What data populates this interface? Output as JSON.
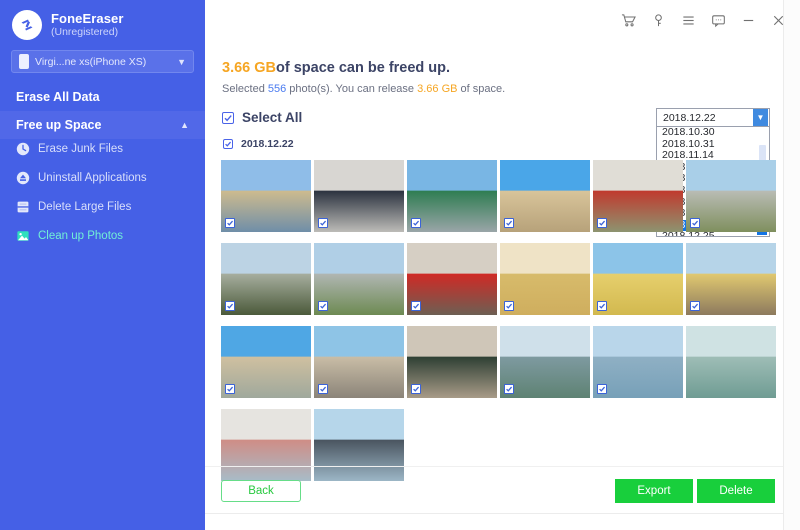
{
  "app": {
    "name": "FoneEraser",
    "license": "(Unregistered)",
    "logo_icon": "fone-eraser-logo-icon"
  },
  "sidebar": {
    "device": {
      "name": "Virgi...ne xs(iPhone XS)",
      "icon": "phone-icon",
      "chevron": "chevron-down-icon"
    },
    "sections": [
      {
        "label": "Erase All Data",
        "expanded": false
      },
      {
        "label": "Free up Space",
        "expanded": true,
        "caret": "chevron-up-icon"
      }
    ],
    "items": [
      {
        "label": "Erase Junk Files",
        "icon": "clock-icon",
        "active": false
      },
      {
        "label": "Uninstall Applications",
        "icon": "uninstall-icon",
        "active": false
      },
      {
        "label": "Delete Large Files",
        "icon": "file-icon",
        "active": false
      },
      {
        "label": "Clean up Photos",
        "icon": "photo-icon",
        "active": true
      }
    ]
  },
  "titlebar": {
    "buttons": [
      {
        "name": "cart-icon",
        "label": "Cart"
      },
      {
        "name": "key-icon",
        "label": "Register"
      },
      {
        "name": "menu-icon",
        "label": "Menu"
      },
      {
        "name": "feedback-icon",
        "label": "Feedback"
      },
      {
        "name": "minimize-icon",
        "label": "Minimize"
      },
      {
        "name": "close-icon",
        "label": "Close"
      }
    ]
  },
  "main": {
    "headline_size": "3.66 GB",
    "headline_rest": "of space can be freed up.",
    "subline_prefix": "Selected ",
    "subline_count": "556",
    "subline_mid": " photo(s). You can release ",
    "subline_size": "3.66 GB",
    "subline_suffix": " of space.",
    "select_all_label": "Select All",
    "group_date": "2018.12.22",
    "select_all_checked": true,
    "group_checked": true
  },
  "date_combo": {
    "value": "2018.12.22",
    "open": true,
    "selected": "2018.12.22",
    "options": [
      "2018.10.30",
      "2018.10.31",
      "2018.11.14",
      "2018.11.15",
      "2018.11.19",
      "2018.11.21",
      "2018.12.04",
      "2018.12.05",
      "2018.12.22",
      "2018.12.25"
    ]
  },
  "photos": [
    {
      "id": 1,
      "alt": "grand-lisboa-dome",
      "checked": true,
      "c1": "#8fbde8",
      "c2": "#cdbb8e",
      "c3": "#6f8ea8"
    },
    {
      "id": 2,
      "alt": "shark-mosaic",
      "checked": true,
      "c1": "#d8d6d2",
      "c2": "#2c3340",
      "c3": "#bdbcb8"
    },
    {
      "id": 3,
      "alt": "green-building",
      "checked": true,
      "c1": "#79b6e4",
      "c2": "#2f7d52",
      "c3": "#9aa5a8"
    },
    {
      "id": 4,
      "alt": "ruins-st-paul",
      "checked": true,
      "c1": "#4aa6e8",
      "c2": "#d8c49a",
      "c3": "#b7a27a"
    },
    {
      "id": 5,
      "alt": "red-shrine",
      "checked": true,
      "c1": "#e0ddd6",
      "c2": "#c03a2e",
      "c3": "#8d9470"
    },
    {
      "id": 6,
      "alt": "city-skyline-1",
      "checked": true,
      "c1": "#a9cfe8",
      "c2": "#b9bcb4",
      "c3": "#7f8f5e"
    },
    {
      "id": 7,
      "alt": "hill-view-flag",
      "checked": true,
      "c1": "#bcd3e4",
      "c2": "#a6ad9e",
      "c3": "#4b5a3a"
    },
    {
      "id": 8,
      "alt": "city-skyline-2",
      "checked": true,
      "c1": "#b0cfe6",
      "c2": "#b0b6b2",
      "c3": "#6d8a52"
    },
    {
      "id": 9,
      "alt": "red-bus-street",
      "checked": true,
      "c1": "#d6cfc4",
      "c2": "#cf2a25",
      "c3": "#6d5f53"
    },
    {
      "id": 10,
      "alt": "dumpling-soup",
      "checked": true,
      "c1": "#efe3c6",
      "c2": "#d7bb6b",
      "c3": "#cfae5e"
    },
    {
      "id": 11,
      "alt": "yellow-church",
      "checked": true,
      "c1": "#8cc4e8",
      "c2": "#e6cf6d",
      "c3": "#d2b94f"
    },
    {
      "id": 12,
      "alt": "colonial-street",
      "checked": true,
      "c1": "#b6d4e8",
      "c2": "#e0c870",
      "c3": "#8d7a5e"
    },
    {
      "id": 13,
      "alt": "casino-towers",
      "checked": true,
      "c1": "#4fa7e4",
      "c2": "#cfc0a0",
      "c3": "#9fa89c"
    },
    {
      "id": 14,
      "alt": "monument-column",
      "checked": true,
      "c1": "#8ec4e6",
      "c2": "#c9bda6",
      "c3": "#8b8479"
    },
    {
      "id": 15,
      "alt": "old-train",
      "checked": true,
      "c1": "#cfc6b8",
      "c2": "#2f4034",
      "c3": "#a89b88"
    },
    {
      "id": 16,
      "alt": "sea-bridge-1",
      "checked": true,
      "c1": "#cfe0ea",
      "c2": "#7e9aa0",
      "c3": "#5e8273"
    },
    {
      "id": 17,
      "alt": "sea-boat",
      "checked": true,
      "c1": "#b9d6ea",
      "c2": "#8fb0c4",
      "c3": "#77a0b8"
    },
    {
      "id": 18,
      "alt": "lake-city",
      "checked": false,
      "c1": "#cfe2e3",
      "c2": "#9ebdb6",
      "c3": "#6f9c93"
    },
    {
      "id": 19,
      "alt": "mural-wall",
      "checked": false,
      "c1": "#e6e4e0",
      "c2": "#cf8d86",
      "c3": "#a8bcc8"
    },
    {
      "id": 20,
      "alt": "lighthouse-tower",
      "checked": false,
      "c1": "#b6d6ea",
      "c2": "#4a5560",
      "c3": "#9cb6c6"
    }
  ],
  "footer": {
    "back_label": "Back",
    "export_label": "Export",
    "delete_label": "Delete"
  }
}
